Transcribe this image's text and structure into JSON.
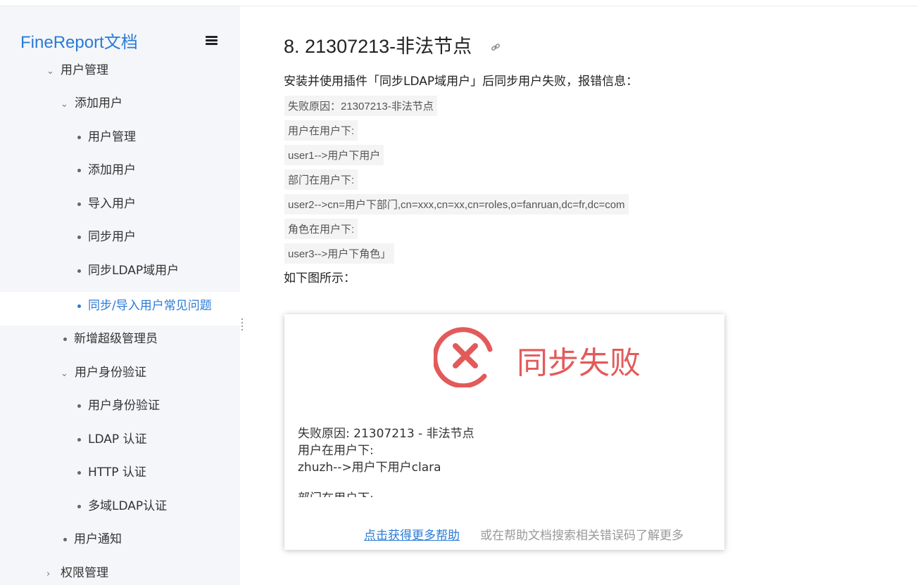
{
  "sidebar": {
    "brand": "FineReport文档",
    "items": [
      {
        "label": "用户管理",
        "marker": "chevron-down"
      },
      {
        "label": "添加用户",
        "marker": "chevron-down"
      },
      {
        "label": "用户管理",
        "marker": "dot"
      },
      {
        "label": "添加用户",
        "marker": "dot"
      },
      {
        "label": "导入用户",
        "marker": "dot"
      },
      {
        "label": "同步用户",
        "marker": "dot"
      },
      {
        "label": "同步LDAP域用户",
        "marker": "dot"
      },
      {
        "label": "同步/导入用户常见问题",
        "marker": "dot",
        "active": true
      },
      {
        "label": "新增超级管理员",
        "marker": "dot"
      },
      {
        "label": "用户身份验证",
        "marker": "chevron-down"
      },
      {
        "label": "用户身份验证",
        "marker": "dot"
      },
      {
        "label": "LDAP 认证",
        "marker": "dot"
      },
      {
        "label": "HTTP 认证",
        "marker": "dot"
      },
      {
        "label": "多域LDAP认证",
        "marker": "dot"
      },
      {
        "label": "用户通知",
        "marker": "dot"
      },
      {
        "label": "权限管理",
        "marker": "chevron-right"
      }
    ]
  },
  "main": {
    "title": "8. 21307213-非法节点",
    "intro": "安装并使用插件「同步LDAP域用户」后同步用户失败，报错信息：",
    "code_lines": [
      "失败原因：21307213-非法节点",
      "用户在用户下:",
      "user1-->用户下用户",
      "部门在用户下:",
      "user2-->cn=用户下部门,cn=xxx,cn=xx,cn=roles,o=fanruan,dc=fr,dc=com",
      "角色在用户下:",
      "user3-->用户下角色」"
    ],
    "outro": "如下图所示："
  },
  "dialog": {
    "title": "同步失败",
    "lines": [
      "失败原因: 21307213 - 非法节点",
      "用户在用户下:",
      "zhuzh-->用户下用户clara"
    ],
    "cut_line": "部门在用户下:",
    "help_link": "点击获得更多帮助",
    "hint": "或在帮助文档搜索相关错误码了解更多"
  },
  "colors": {
    "accent": "#2a7bd6",
    "error": "#e35a5a",
    "sidebar_bg": "#f4f6f9"
  }
}
